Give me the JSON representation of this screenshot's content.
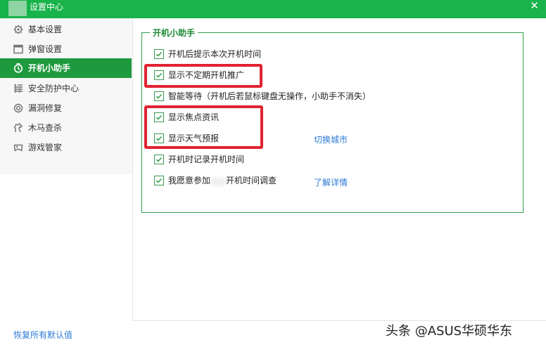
{
  "window": {
    "title": "设置中心",
    "close_glyph": "✕"
  },
  "sidebar": {
    "items": [
      {
        "label": "基本设置",
        "icon": "gear-icon"
      },
      {
        "label": "弹窗设置",
        "icon": "window-icon"
      },
      {
        "label": "开机小助手",
        "icon": "power-clock-icon",
        "active": true
      },
      {
        "label": "安全防护中心",
        "icon": "shield-grid-icon"
      },
      {
        "label": "漏洞修复",
        "icon": "patch-icon"
      },
      {
        "label": "木马查杀",
        "icon": "horse-icon"
      },
      {
        "label": "游戏管家",
        "icon": "gamepad-icon"
      }
    ],
    "reset_label": "恢复所有默认值"
  },
  "section": {
    "title": "开机小助手",
    "options": [
      {
        "label": "开机后提示本次开机时间",
        "checked": true
      },
      {
        "label": "显示不定期开机推广",
        "checked": true
      },
      {
        "label": "智能等待（开机后若鼠标键盘无操作，小助手不消失）",
        "checked": true
      },
      {
        "label": "显示焦点资讯",
        "checked": true
      },
      {
        "label": "显示天气预报",
        "checked": true
      },
      {
        "label": "开机时记录开机时间",
        "checked": true
      },
      {
        "label": "我愿意参加",
        "label_tail": "开机时间调查",
        "checked": true
      }
    ],
    "switch_city_link": "切换城市",
    "details_link": "了解详情"
  },
  "watermark": "头条 @ASUS华硕华东",
  "colors": {
    "accent": "#18b34a",
    "active_nav": "#1e9a3e",
    "link": "#2e7ad6",
    "highlight": "#e02332"
  }
}
